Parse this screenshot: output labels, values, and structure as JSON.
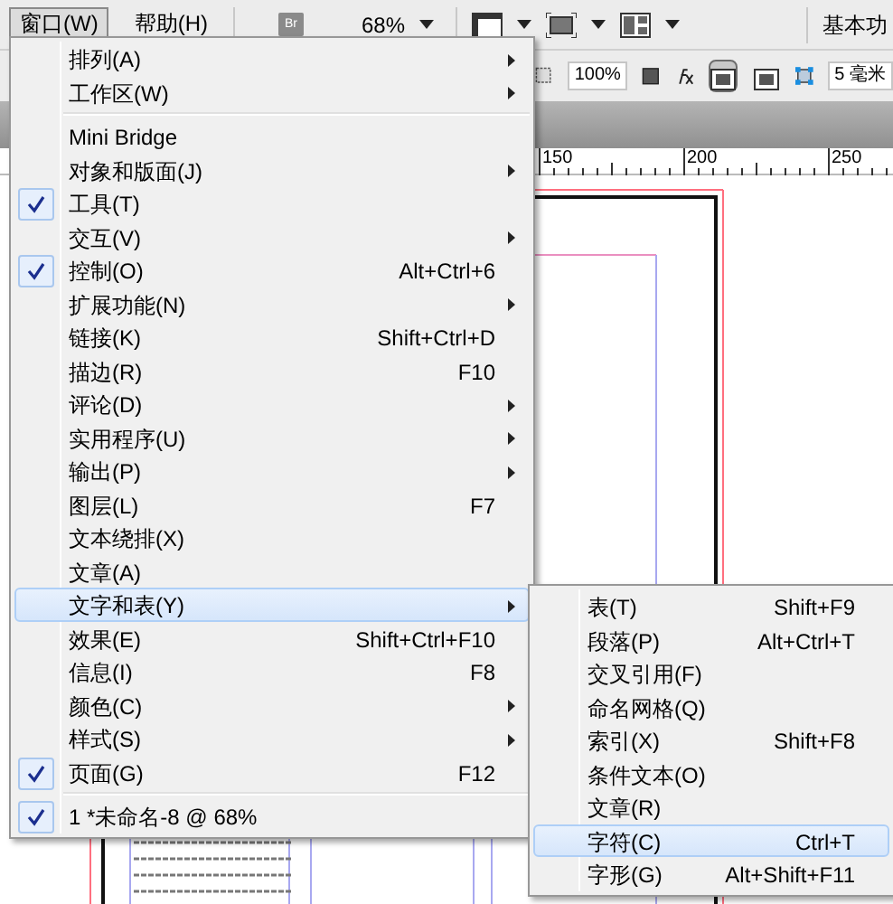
{
  "menubar": {
    "items": [
      {
        "label": "窗口(W)",
        "selected": true
      },
      {
        "label": "帮助(H)",
        "selected": false
      }
    ],
    "bridge_button": "Br",
    "zoom": "68%",
    "workspace": "基本功"
  },
  "control_panel": {
    "fields": [
      "100%",
      "5 毫米"
    ],
    "toggles": [
      {
        "selected": true
      },
      {
        "selected": false
      }
    ]
  },
  "ruler": {
    "labels": [
      "150",
      "200",
      "250"
    ]
  },
  "menu": {
    "items": [
      {
        "kind": "item",
        "label": "排列(A)",
        "submenu": true,
        "checked": false,
        "selected": false
      },
      {
        "kind": "item",
        "label": "工作区(W)",
        "submenu": true,
        "checked": false,
        "selected": false
      },
      {
        "kind": "separator"
      },
      {
        "kind": "item",
        "label": "Mini Bridge",
        "submenu": false,
        "checked": false,
        "selected": false
      },
      {
        "kind": "item",
        "label": "对象和版面(J)",
        "submenu": true,
        "checked": false,
        "selected": false
      },
      {
        "kind": "item",
        "label": "工具(T)",
        "submenu": false,
        "checked": true,
        "selected": false
      },
      {
        "kind": "item",
        "label": "交互(V)",
        "submenu": true,
        "checked": false,
        "selected": false
      },
      {
        "kind": "item",
        "label": "控制(O)",
        "shortcut": "Alt+Ctrl+6",
        "submenu": false,
        "checked": true,
        "selected": false
      },
      {
        "kind": "item",
        "label": "扩展功能(N)",
        "submenu": true,
        "checked": false,
        "selected": false
      },
      {
        "kind": "item",
        "label": "链接(K)",
        "shortcut": "Shift+Ctrl+D",
        "submenu": false,
        "checked": false,
        "selected": false
      },
      {
        "kind": "item",
        "label": "描边(R)",
        "shortcut": "F10",
        "submenu": false,
        "checked": false,
        "selected": false
      },
      {
        "kind": "item",
        "label": "评论(D)",
        "submenu": true,
        "checked": false,
        "selected": false
      },
      {
        "kind": "item",
        "label": "实用程序(U)",
        "submenu": true,
        "checked": false,
        "selected": false
      },
      {
        "kind": "item",
        "label": "输出(P)",
        "submenu": true,
        "checked": false,
        "selected": false
      },
      {
        "kind": "item",
        "label": "图层(L)",
        "shortcut": "F7",
        "submenu": false,
        "checked": false,
        "selected": false
      },
      {
        "kind": "item",
        "label": "文本绕排(X)",
        "submenu": false,
        "checked": false,
        "selected": false
      },
      {
        "kind": "item",
        "label": "文章(A)",
        "submenu": false,
        "checked": false,
        "selected": false
      },
      {
        "kind": "item",
        "label": "文字和表(Y)",
        "submenu": true,
        "checked": false,
        "selected": true
      },
      {
        "kind": "item",
        "label": "效果(E)",
        "shortcut": "Shift+Ctrl+F10",
        "submenu": false,
        "checked": false,
        "selected": false
      },
      {
        "kind": "item",
        "label": "信息(I)",
        "shortcut": "F8",
        "submenu": false,
        "checked": false,
        "selected": false
      },
      {
        "kind": "item",
        "label": "颜色(C)",
        "submenu": true,
        "checked": false,
        "selected": false
      },
      {
        "kind": "item",
        "label": "样式(S)",
        "submenu": true,
        "checked": false,
        "selected": false
      },
      {
        "kind": "item",
        "label": "页面(G)",
        "shortcut": "F12",
        "submenu": false,
        "checked": true,
        "selected": false
      },
      {
        "kind": "separator"
      },
      {
        "kind": "item",
        "label": "1 *未命名-8 @ 68%",
        "submenu": false,
        "checked": true,
        "selected": false
      }
    ]
  },
  "submenu": {
    "items": [
      {
        "kind": "item",
        "label": "表(T)",
        "shortcut": "Shift+F9",
        "submenu": false,
        "checked": false,
        "selected": false
      },
      {
        "kind": "item",
        "label": "段落(P)",
        "shortcut": "Alt+Ctrl+T",
        "submenu": false,
        "checked": false,
        "selected": false
      },
      {
        "kind": "item",
        "label": "交叉引用(F)",
        "submenu": false,
        "checked": false,
        "selected": false
      },
      {
        "kind": "item",
        "label": "命名网格(Q)",
        "submenu": false,
        "checked": false,
        "selected": false
      },
      {
        "kind": "item",
        "label": "索引(X)",
        "shortcut": "Shift+F8",
        "submenu": false,
        "checked": false,
        "selected": false
      },
      {
        "kind": "item",
        "label": "条件文本(O)",
        "submenu": false,
        "checked": false,
        "selected": false
      },
      {
        "kind": "item",
        "label": "文章(R)",
        "submenu": false,
        "checked": false,
        "selected": false
      },
      {
        "kind": "item",
        "label": "字符(C)",
        "shortcut": "Ctrl+T",
        "submenu": false,
        "checked": false,
        "selected": true
      },
      {
        "kind": "item",
        "label": "字形(G)",
        "shortcut": "Alt+Shift+F11",
        "submenu": false,
        "checked": false,
        "selected": false
      }
    ]
  }
}
